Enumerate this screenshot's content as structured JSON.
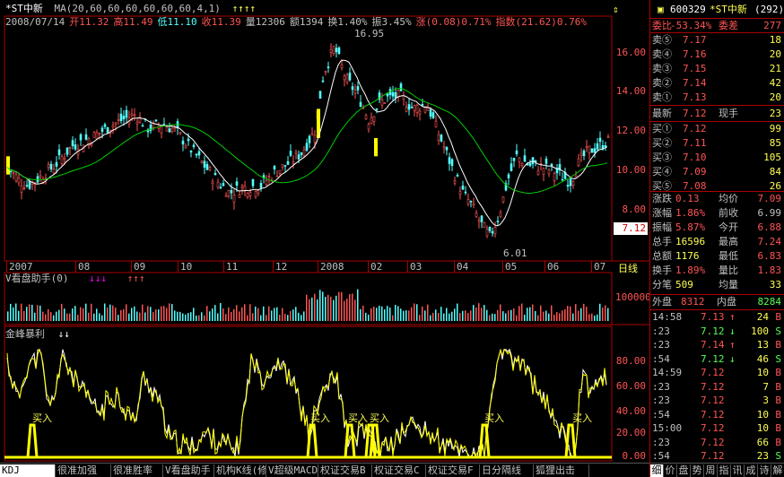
{
  "title": {
    "name": "*ST中新",
    "ma": "MA(20,60,60,60,60,60,60,4,1)",
    "arrows": "↑↑↑↑"
  },
  "info": {
    "date": "2008/07/14",
    "open_l": "开",
    "open": "11.32",
    "high_l": "高",
    "high": "11.49",
    "low_l": "低",
    "low": "11.10",
    "close_l": "收",
    "close": "11.39",
    "vol_l": "量",
    "vol": "12306",
    "amt_l": "额",
    "amt": "1394",
    "turn_l": "换",
    "turn": "1.40%",
    "amp_l": "振",
    "amp": "3.45%",
    "chg_l": "涨",
    "chg": "(0.08)",
    "chgp": "0.71%",
    "idx_l": "指数",
    "idx": "(21.62)",
    "idxp": "0.76%"
  },
  "price_axis": [
    "16.00",
    "14.00",
    "12.00",
    "10.00",
    "8.00"
  ],
  "price_marker": "7.12",
  "high_mark": "16.95",
  "low_mark": "6.01",
  "time_axis": [
    "2007",
    "08",
    "09",
    "10",
    "11",
    "12",
    "2008",
    "02",
    "03",
    "04",
    "05",
    "06",
    "07"
  ],
  "period_label": "日线",
  "ind1": {
    "name": "V看盘助手(0)",
    "arrows1": "↓↓↓",
    "arrows2": "↑↑↑",
    "axis": "100000"
  },
  "ind2": {
    "name": "金峰暴利",
    "arrows": "↓↓",
    "axis": [
      "80.00",
      "60.00",
      "40.00",
      "20.00",
      "0.00"
    ],
    "buy": "买入"
  },
  "chart_data": [
    {
      "type": "candlestick",
      "title": "*ST中新",
      "ylim": [
        5.5,
        17.5
      ],
      "yticks": [
        16,
        14,
        12,
        10,
        8
      ],
      "xticks": [
        "2007",
        "08",
        "09",
        "10",
        "11",
        "12",
        "2008",
        "02",
        "03",
        "04",
        "05",
        "06",
        "07"
      ],
      "annotations": [
        {
          "text": "16.95"
        },
        {
          "text": "6.01"
        }
      ],
      "current": 7.12
    },
    {
      "type": "bar",
      "title": "V看盘助手(0)",
      "yticks": [
        100000
      ]
    },
    {
      "type": "line",
      "title": "金峰暴利",
      "ylim": [
        0,
        100
      ],
      "yticks": [
        80,
        60,
        40,
        20,
        0
      ],
      "annotations": [
        {
          "text": "买入"
        }
      ]
    }
  ],
  "right": {
    "code": "600329",
    "name": "*ST中新",
    "count": "(292)",
    "weibi_l": "委比",
    "weibi": "-53.34%",
    "weicha_l": "委差",
    "weicha": "277",
    "sells": [
      {
        "l": "卖⑤",
        "p": "7.17",
        "v": "18"
      },
      {
        "l": "卖④",
        "p": "7.16",
        "v": "20"
      },
      {
        "l": "卖③",
        "p": "7.15",
        "v": "21"
      },
      {
        "l": "卖②",
        "p": "7.14",
        "v": "42"
      },
      {
        "l": "卖①",
        "p": "7.13",
        "v": "20"
      }
    ],
    "latest_l": "最新",
    "latest": "7.12",
    "xianshou_l": "现手",
    "xianshou": "23",
    "buys": [
      {
        "l": "买①",
        "p": "7.12",
        "v": "99"
      },
      {
        "l": "买②",
        "p": "7.11",
        "v": "85"
      },
      {
        "l": "买③",
        "p": "7.10",
        "v": "105"
      },
      {
        "l": "买④",
        "p": "7.09",
        "v": "84"
      },
      {
        "l": "买⑤",
        "p": "7.08",
        "v": "26"
      }
    ],
    "stats": [
      {
        "a": "涨跌",
        "av": "0.13",
        "b": "均价",
        "bv": "7.09"
      },
      {
        "a": "涨幅",
        "av": "1.86%",
        "b": "前收",
        "bv": "6.99"
      },
      {
        "a": "振幅",
        "av": "5.87%",
        "b": "今开",
        "bv": "6.88"
      },
      {
        "a": "总手",
        "av": "16596",
        "b": "最高",
        "bv": "7.24"
      },
      {
        "a": "总额",
        "av": "1176",
        "b": "最低",
        "bv": "6.83"
      },
      {
        "a": "换手",
        "av": "1.89%",
        "b": "量比",
        "bv": "1.83"
      },
      {
        "a": "分笔",
        "av": "509",
        "b": "均量",
        "bv": "33"
      }
    ],
    "waipan_l": "外盘",
    "waipan": "8312",
    "neipan_l": "内盘",
    "neipan": "8284",
    "ticks": [
      {
        "t": "14:58",
        "p": "7.13",
        "a": "↑",
        "v": "24",
        "s": "B"
      },
      {
        "t": ":23",
        "p": "7.12",
        "a": "↓",
        "v": "100",
        "s": "S"
      },
      {
        "t": ":23",
        "p": "7.14",
        "a": "↑",
        "v": "13",
        "s": "B"
      },
      {
        "t": ":54",
        "p": "7.12",
        "a": "↓",
        "v": "46",
        "s": "S"
      },
      {
        "t": "14:59",
        "p": "7.12",
        "a": "",
        "v": "10",
        "s": "B"
      },
      {
        "t": ":23",
        "p": "7.12",
        "a": "",
        "v": "7",
        "s": "B"
      },
      {
        "t": ":23",
        "p": "7.12",
        "a": "",
        "v": "3",
        "s": "B"
      },
      {
        "t": ":54",
        "p": "7.12",
        "a": "",
        "v": "10",
        "s": "B"
      },
      {
        "t": "15:00",
        "p": "7.12",
        "a": "",
        "v": "10",
        "s": "B"
      },
      {
        "t": ":23",
        "p": "7.12",
        "a": "",
        "v": "66",
        "s": "B"
      },
      {
        "t": ":54",
        "p": "7.12",
        "a": "",
        "v": "23",
        "s": "S"
      }
    ],
    "bottom_tabs": [
      "细",
      "价",
      "盘",
      "势",
      "周",
      "指",
      "讯",
      "成",
      "诗",
      "解"
    ]
  },
  "tabs": [
    "KDJ",
    "很准加强",
    "很准胜率",
    "V看盘助手",
    "机构K线(修",
    "V超级MACD",
    "权证交易B",
    "权证交易C",
    "权证交易F",
    "日分隔线",
    "狐狸出击"
  ]
}
